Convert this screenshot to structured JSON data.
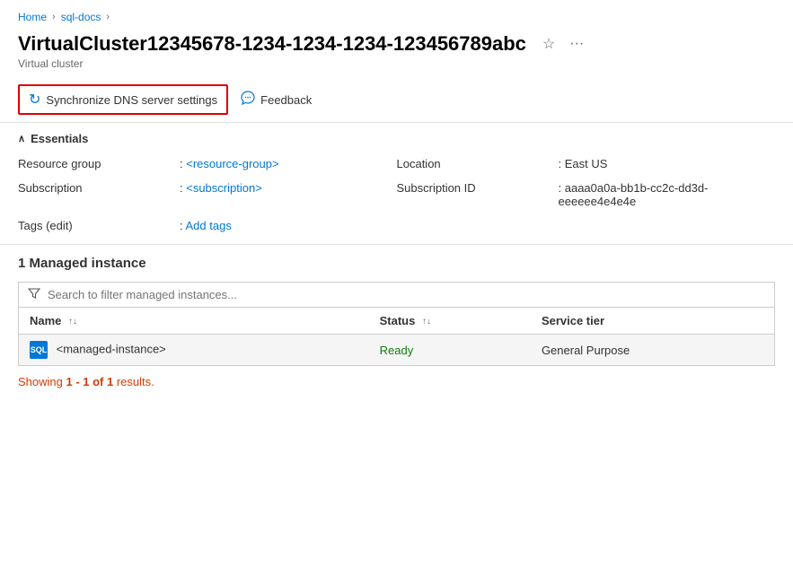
{
  "breadcrumb": {
    "home": "Home",
    "sqldocs": "sql-docs"
  },
  "header": {
    "title": "VirtualCluster12345678-1234-1234-1234-123456789abc",
    "subtitle": "Virtual cluster",
    "pin_icon": "pin-icon",
    "more_icon": "more-icon"
  },
  "toolbar": {
    "sync_label": "Synchronize DNS server settings",
    "feedback_label": "Feedback"
  },
  "essentials": {
    "section_label": "Essentials",
    "fields": [
      {
        "label": "Resource group",
        "value": "<resource-group>",
        "is_link": true
      },
      {
        "label": "Location",
        "value": "East US",
        "is_link": false
      },
      {
        "label": "Subscription",
        "value": "<subscription>",
        "is_link": true
      },
      {
        "label": "Subscription ID",
        "value": "aaaa0a0a-bb1b-cc2c-dd3d-eeeeee4e4e4e",
        "is_link": false
      },
      {
        "label": "Tags (edit)",
        "value": "Add tags",
        "is_link": true,
        "label_has_link": true
      }
    ]
  },
  "managed_instances": {
    "section_title": "1 Managed instance",
    "search_placeholder": "Search to filter managed instances...",
    "columns": [
      {
        "label": "Name",
        "sortable": true
      },
      {
        "label": "Status",
        "sortable": true
      },
      {
        "label": "Service tier",
        "sortable": false
      }
    ],
    "rows": [
      {
        "name": "<managed-instance>",
        "status": "Ready",
        "service_tier": "General Purpose"
      }
    ],
    "showing_text": "Showing ",
    "showing_range": "1 - 1 of 1",
    "showing_suffix": " results."
  }
}
